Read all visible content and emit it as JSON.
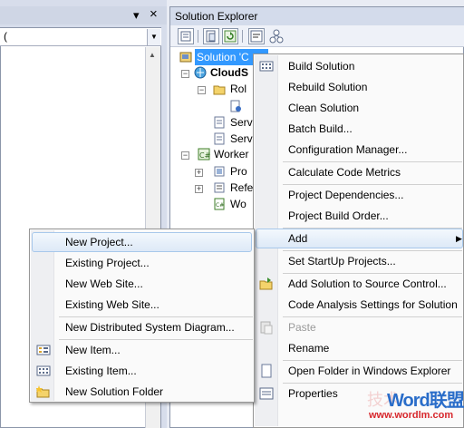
{
  "left_pane": {
    "pin_glyph": "▾",
    "close_glyph": "×",
    "combo_text": "(",
    "scroll_up": "▲"
  },
  "solution_explorer": {
    "title": "Solution Explorer",
    "tree": {
      "solution_label": "Solution 'C",
      "project_label": "CloudS",
      "roles_label": "Rol",
      "serv1_label": "Serv",
      "serv2_label": "Serv",
      "worker_label": "Worker",
      "prop_label": "Pro",
      "refs_label": "Refe",
      "wo_label": "Wo"
    }
  },
  "context_menu": {
    "items": [
      {
        "label": "Build Solution"
      },
      {
        "label": "Rebuild Solution"
      },
      {
        "label": "Clean Solution"
      },
      {
        "label": "Batch Build..."
      },
      {
        "label": "Configuration Manager..."
      },
      {
        "label": "Calculate Code Metrics"
      },
      {
        "label": "Project Dependencies..."
      },
      {
        "label": "Project Build Order..."
      },
      {
        "label": "Add"
      },
      {
        "label": "Set StartUp Projects..."
      },
      {
        "label": "Add Solution to Source Control..."
      },
      {
        "label": "Code Analysis Settings for Solution"
      },
      {
        "label": "Paste"
      },
      {
        "label": "Rename"
      },
      {
        "label": "Open Folder in Windows Explorer"
      },
      {
        "label": "Properties"
      }
    ]
  },
  "add_submenu": {
    "items": [
      {
        "label": "New Project..."
      },
      {
        "label": "Existing Project..."
      },
      {
        "label": "New Web Site..."
      },
      {
        "label": "Existing Web Site..."
      },
      {
        "label": "New Distributed System Diagram..."
      },
      {
        "label": "New Item..."
      },
      {
        "label": "Existing Item..."
      },
      {
        "label": "New Solution Folder"
      }
    ]
  },
  "watermark": {
    "brand": "Word联盟",
    "left_text": "技术",
    "url": "www.wordlm.com"
  },
  "colors": {
    "selection": "#3399ff",
    "menu_highlight_border": "#a8c8eb",
    "watermark_blue": "#2a6dc9"
  }
}
